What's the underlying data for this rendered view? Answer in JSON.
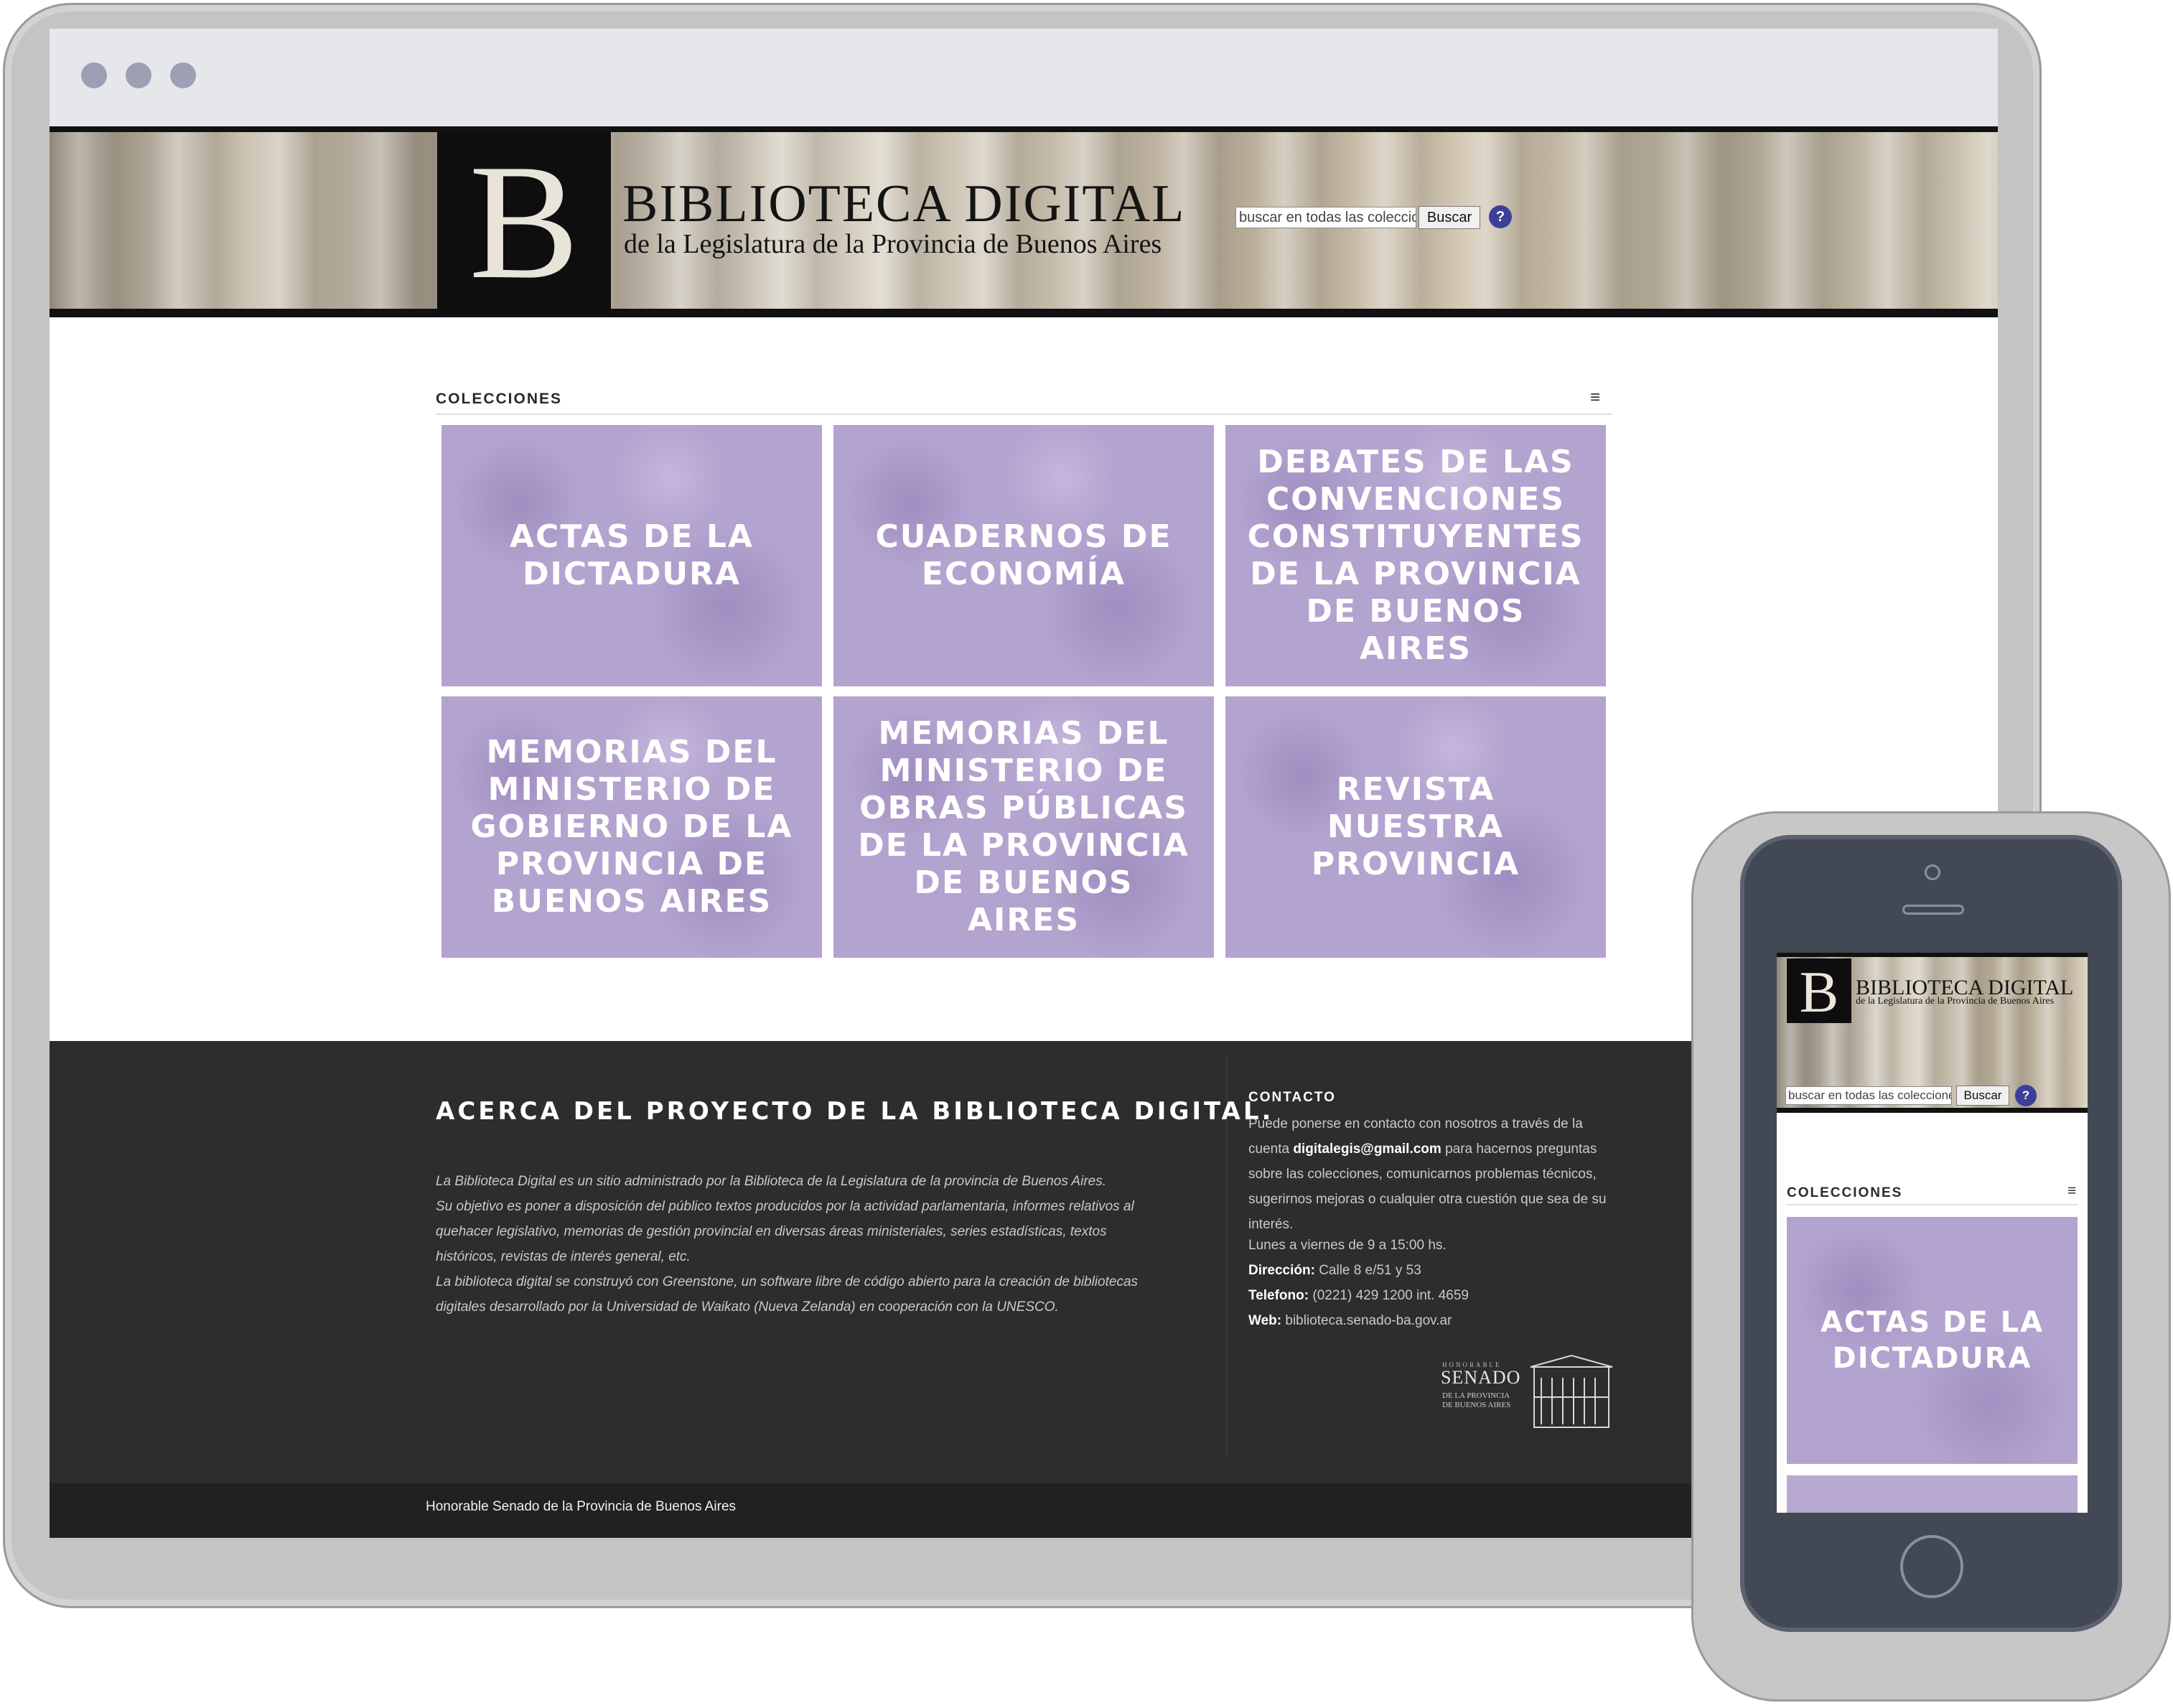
{
  "brand": {
    "logo_letter": "B",
    "title": "BIBLIOTECA DIGITAL",
    "subtitle": "de la Legislatura de la Provincia de Buenos Aires"
  },
  "search": {
    "placeholder": "buscar en todas las colecciones",
    "button_label": "Buscar",
    "help_label": "?"
  },
  "collections": {
    "header": "COLECCIONES",
    "menu_icon": "≡",
    "items": [
      {
        "label": "Actas de la Dictadura"
      },
      {
        "label": "Cuadernos de Economía"
      },
      {
        "label": "Debates de las Convenciones Constituyentes de la Provincia de Buenos Aires"
      },
      {
        "label": "Memorias del Ministerio de Gobierno de la Provincia de Buenos Aires"
      },
      {
        "label": "Memorias del Ministerio de Obras Públicas de la Provincia de Buenos Aires"
      },
      {
        "label": "Revista Nuestra Provincia"
      }
    ],
    "tile_color": "#b3a3cf"
  },
  "about": {
    "title": "ACERCA DEL PROYECTO DE LA BIBLIOTECA DIGITAL.",
    "lines": [
      "La Biblioteca Digital es un sitio administrado por la Biblioteca de la Legislatura de la provincia de Buenos Aires.",
      "Su objetivo es poner a disposición del público textos producidos por la actividad parlamentaria, informes relativos al",
      "quehacer legislativo, memorias de gestión provincial en diversas áreas ministeriales, series estadísticas, textos",
      "históricos, revistas de interés general, etc.",
      "La biblioteca digital se construyó con Greenstone, un software libre de código abierto para la creación de bibliotecas",
      "digitales desarrollado por la Universidad de Waikato (Nueva Zelanda) en cooperación con la UNESCO."
    ]
  },
  "contact": {
    "title": "CONTACTO",
    "intro_before": "Puede ponerse en contacto con nosotros a través de la cuenta ",
    "email": "digitalegis@gmail.com",
    "intro_after": " para hacernos preguntas sobre las colecciones, comunicarnos problemas técnicos, sugerirnos mejoras o cualquier otra cuestión que sea de su interés.",
    "hours": "Lunes a viernes de 9 a 15:00 hs.",
    "address_label": "Dirección:",
    "address": " Calle 8 e/51 y 53",
    "phone_label": "Telefono:",
    "phone": " (0221) 429 1200 int. 4659",
    "web_label": "Web:",
    "web": " biblioteca.senado-ba.gov.ar"
  },
  "senado_logo": {
    "top": "HONORABLE",
    "word": "SENADO",
    "line1": "DE LA PROVINCIA",
    "line2": "DE BUENOS AIRES"
  },
  "footer": {
    "copyright": "Honorable Senado de la Provincia de Buenos Aires"
  },
  "mobile": {
    "visible_collection": "Actas de la Dictadura"
  },
  "colors": {
    "footer_bg": "#2d2d2d",
    "footer_bottom_bg": "#212121",
    "tile": "#b3a3cf",
    "help_button": "#3b3f9a"
  }
}
